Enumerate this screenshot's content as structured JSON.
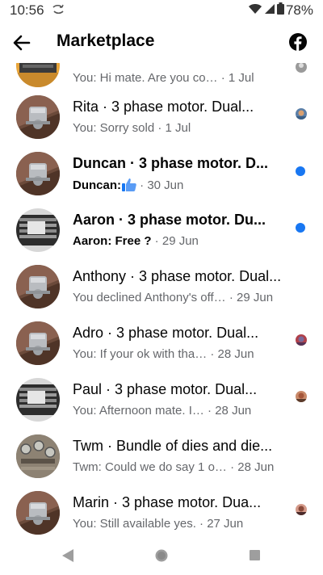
{
  "status_bar": {
    "time": "10:56",
    "battery": "78%"
  },
  "header": {
    "title": "Marketplace"
  },
  "top_row": {
    "subtitle": "You: Hi mate. Are you co… · 1 Jul"
  },
  "rows": [
    {
      "title": "Rita · 3 phase motor. Dual...",
      "sub_sender": "",
      "sub_text": "You: Sorry sold · 1 Jul",
      "unread": false
    },
    {
      "title": "Duncan · 3 phase motor. D...",
      "sub_sender": "Duncan:",
      "sub_text": " · 30 Jun",
      "unread": true
    },
    {
      "title": "Aaron · 3 phase motor. Du...",
      "sub_sender": "Aaron: Free ?",
      "sub_text": " · 29 Jun",
      "unread": true
    },
    {
      "title": "Anthony · 3 phase motor. Dual...",
      "sub_sender": "",
      "sub_text": "You declined Anthony's off… · 29 Jun",
      "unread": false
    },
    {
      "title": "Adro · 3 phase motor. Dual...",
      "sub_sender": "",
      "sub_text": "You: If your ok with tha… · 28 Jun",
      "unread": false
    },
    {
      "title": "Paul · 3 phase motor. Dual...",
      "sub_sender": "",
      "sub_text": "You: Afternoon mate. I… · 28 Jun",
      "unread": false
    },
    {
      "title": "Twm · Bundle of dies and die...",
      "sub_sender": "",
      "sub_text": "Twm: Could we do say 1 o… · 28 Jun",
      "unread": false
    },
    {
      "title": "Marin · 3 phase motor. Dua...",
      "sub_sender": "",
      "sub_text": "You: Still available yes. · 27 Jun",
      "unread": false
    }
  ],
  "icons": {
    "back": "arrow-left-icon",
    "facebook": "facebook-icon",
    "thumbs_up": "thumbs-up-icon",
    "nav_back": "triangle-back-icon",
    "nav_home": "circle-home-icon",
    "nav_recents": "square-recents-icon"
  },
  "colors": {
    "unread_dot": "#1877f2",
    "secondary_text": "#65676b",
    "primary_text": "#050505"
  }
}
